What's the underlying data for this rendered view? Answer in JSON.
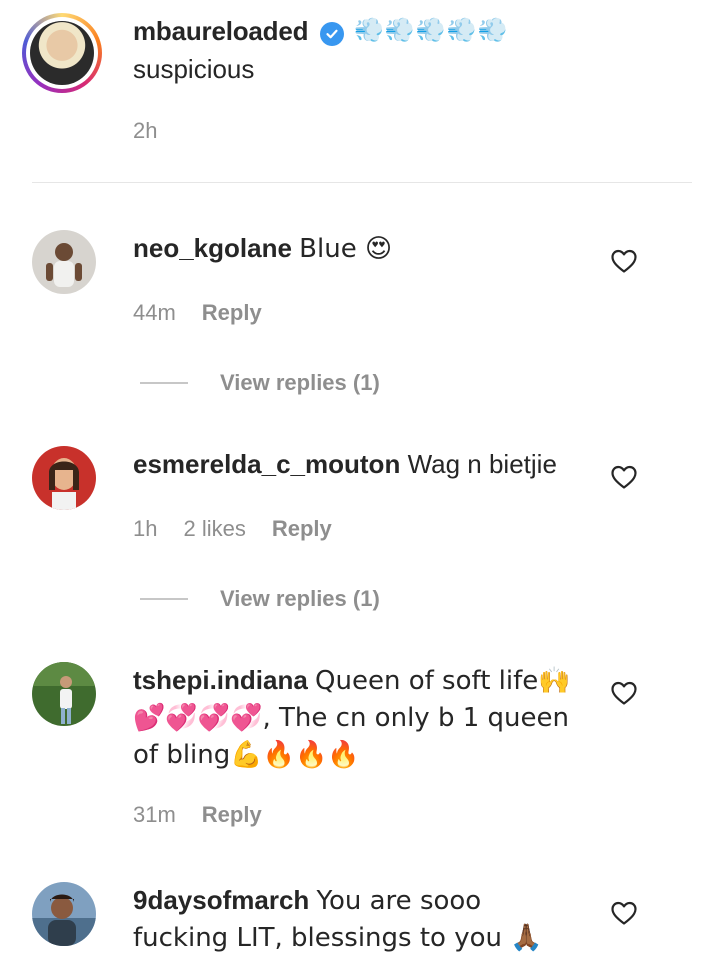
{
  "caption": {
    "username": "mbaureloaded",
    "verified": true,
    "emojis": "💨💨💨💨💨",
    "text": "suspicious",
    "time": "2h"
  },
  "comments": [
    {
      "username": "neo_kgolane",
      "text": "Blue 😍",
      "time": "44m",
      "likes": "",
      "reply_label": "Reply",
      "view_replies": "View replies (1)"
    },
    {
      "username": "esmerelda_c_mouton",
      "text": "Wag n bietjie",
      "time": "1h",
      "likes": "2 likes",
      "reply_label": "Reply",
      "view_replies": "View replies (1)"
    },
    {
      "username": "tshepi.indiana",
      "text": "Queen of soft life🙌 💕💞💞💞, The cn only b 1 queen of bling💪🔥🔥🔥",
      "time": "31m",
      "likes": "",
      "reply_label": "Reply"
    },
    {
      "username": "9daysofmarch",
      "text": "You are sooo fucking LIT, blessings to you 🙏🏾"
    }
  ],
  "colors": {
    "text": "#262626",
    "muted": "#8e8e8e",
    "verified": "#3897f0",
    "divider": "#e6e6e6"
  },
  "icons": {
    "verified": "verified-badge-icon",
    "like": "heart-outline-icon"
  }
}
